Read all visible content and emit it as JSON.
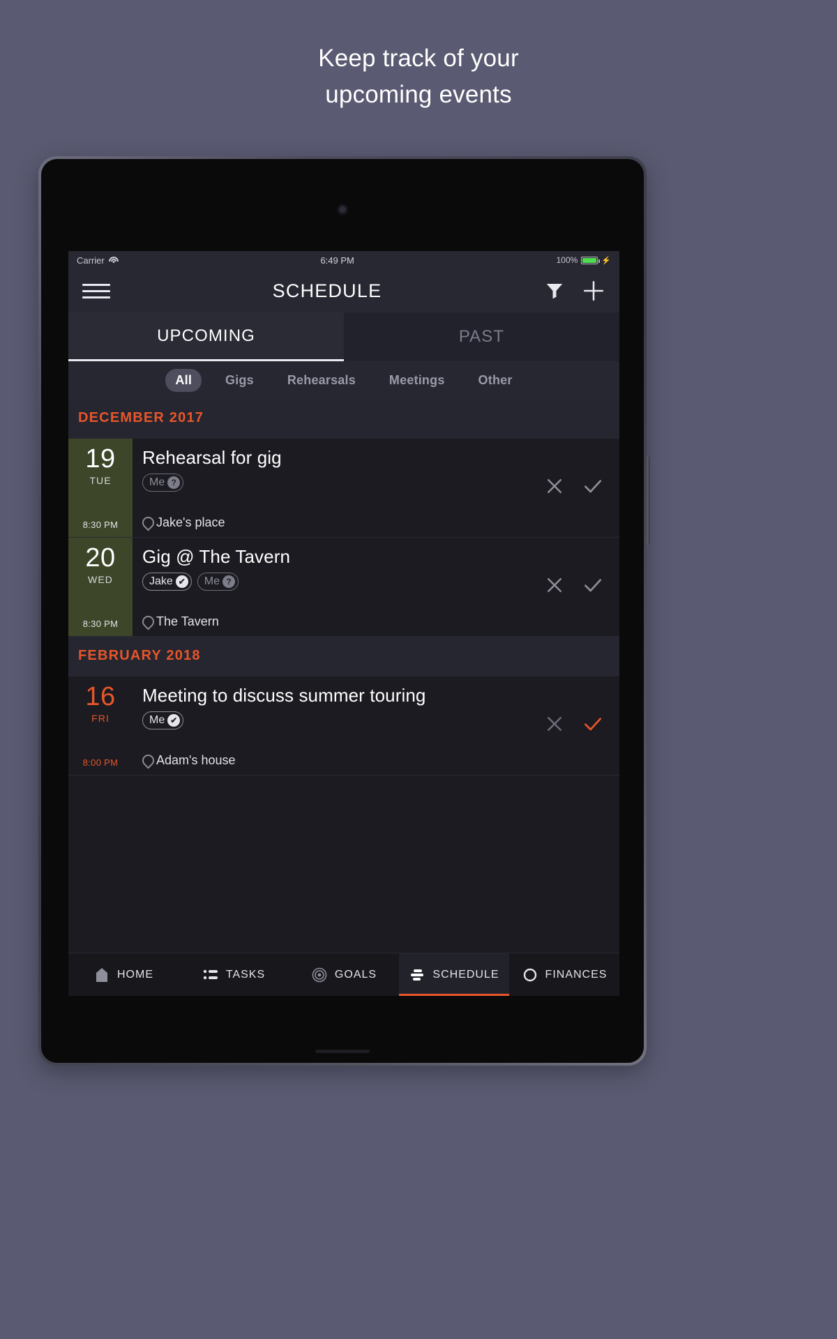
{
  "marketing": {
    "headline_line1": "Keep track of your",
    "headline_line2": "upcoming events"
  },
  "colors": {
    "background": "#5a5a72",
    "accent_orange": "#e8562a",
    "screen_bg": "#1b1b21",
    "bar_bg": "#282833",
    "date_green": "#3d4628",
    "battery_green": "#4ddd4d"
  },
  "statusbar": {
    "carrier": "Carrier",
    "wifi_icon": "wifi-icon",
    "time": "6:49 PM",
    "battery_percent": "100%",
    "battery_icon": "battery-full-icon",
    "charging_icon": "lightning-bolt-icon"
  },
  "navbar": {
    "menu_icon": "hamburger-menu-icon",
    "title": "SCHEDULE",
    "filter_icon": "filter-funnel-icon",
    "add_icon": "plus-icon"
  },
  "tabs": [
    {
      "label": "UPCOMING",
      "active": true
    },
    {
      "label": "PAST",
      "active": false
    }
  ],
  "filters": [
    {
      "label": "All",
      "active": true
    },
    {
      "label": "Gigs",
      "active": false
    },
    {
      "label": "Rehearsals",
      "active": false
    },
    {
      "label": "Meetings",
      "active": false
    },
    {
      "label": "Other",
      "active": false
    }
  ],
  "sections": [
    {
      "month": "DECEMBER 2017",
      "events": [
        {
          "day": "19",
          "dow": "TUE",
          "time": "8:30 PM",
          "date_style": "green",
          "title": "Rehearsal for gig",
          "attendees": [
            {
              "name": "Me",
              "status": "pending",
              "badge": "?"
            }
          ],
          "location": "Jake's place",
          "location_icon": "map-pin-icon",
          "decline_icon": "close-x-icon",
          "accept_icon": "check-icon",
          "accept_state": "neutral"
        },
        {
          "day": "20",
          "dow": "WED",
          "time": "8:30 PM",
          "date_style": "green",
          "title": "Gig @ The Tavern",
          "attendees": [
            {
              "name": "Jake",
              "status": "accepted",
              "badge": "✔"
            },
            {
              "name": "Me",
              "status": "pending",
              "badge": "?"
            }
          ],
          "location": "The Tavern",
          "location_icon": "map-pin-icon",
          "decline_icon": "close-x-icon",
          "accept_icon": "check-icon",
          "accept_state": "neutral"
        }
      ]
    },
    {
      "month": "FEBRUARY 2018",
      "events": [
        {
          "day": "16",
          "dow": "FRI",
          "time": "8:00 PM",
          "date_style": "plain",
          "title": "Meeting to discuss summer touring",
          "attendees": [
            {
              "name": "Me",
              "status": "accepted",
              "badge": "✔"
            }
          ],
          "location": "Adam's house",
          "location_icon": "map-pin-icon",
          "decline_icon": "close-x-icon",
          "accept_icon": "check-icon",
          "accept_state": "accepted"
        }
      ]
    }
  ],
  "bottomnav": [
    {
      "label": "HOME",
      "icon": "home-icon",
      "active": false
    },
    {
      "label": "TASKS",
      "icon": "list-icon",
      "active": false
    },
    {
      "label": "GOALS",
      "icon": "target-icon",
      "active": false
    },
    {
      "label": "SCHEDULE",
      "icon": "schedule-icon",
      "active": true
    },
    {
      "label": "FINANCES",
      "icon": "coin-icon",
      "active": false
    }
  ]
}
